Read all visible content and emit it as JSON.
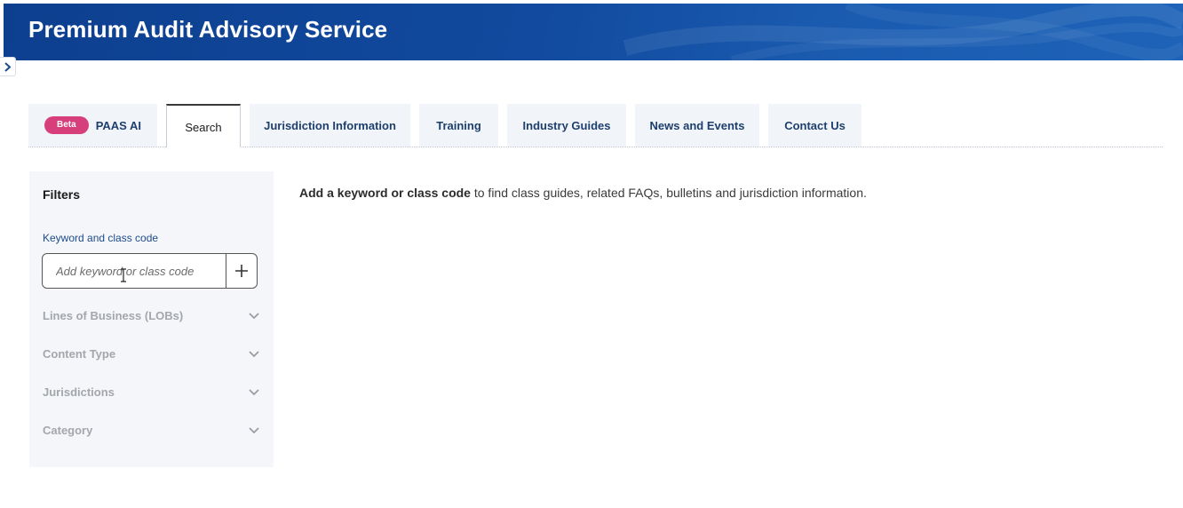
{
  "app": {
    "title": "Premium Audit Advisory Service"
  },
  "tabs": [
    {
      "label": "PAAS AI",
      "badge": "Beta",
      "active": false
    },
    {
      "label": "Search",
      "active": true
    },
    {
      "label": "Jurisdiction Information",
      "active": false
    },
    {
      "label": "Training",
      "active": false
    },
    {
      "label": "Industry Guides",
      "active": false
    },
    {
      "label": "News and Events",
      "active": false
    },
    {
      "label": "Contact Us",
      "active": false
    }
  ],
  "filters": {
    "title": "Filters",
    "keyword_label": "Keyword and class code",
    "keyword_value": "",
    "keyword_placeholder": "Add keyword or class code",
    "add_icon": "plus-icon",
    "sections": [
      {
        "label": "Lines of Business (LOBs)",
        "icon": "chevron-down-icon"
      },
      {
        "label": "Content Type",
        "icon": "chevron-down-icon"
      },
      {
        "label": "Jurisdictions",
        "icon": "chevron-down-icon"
      },
      {
        "label": "Category",
        "icon": "chevron-down-icon"
      }
    ]
  },
  "intro": {
    "bold": "Add a keyword or class code",
    "rest": " to find class guides, related FAQs, bulletins and jurisdiction information."
  },
  "colors": {
    "banner": "#114a9e",
    "beta_badge": "#d63e7c",
    "tab_text": "#1e3f6e",
    "label_blue": "#1d4b8c",
    "filter_panel_bg": "#f5f6f9"
  }
}
